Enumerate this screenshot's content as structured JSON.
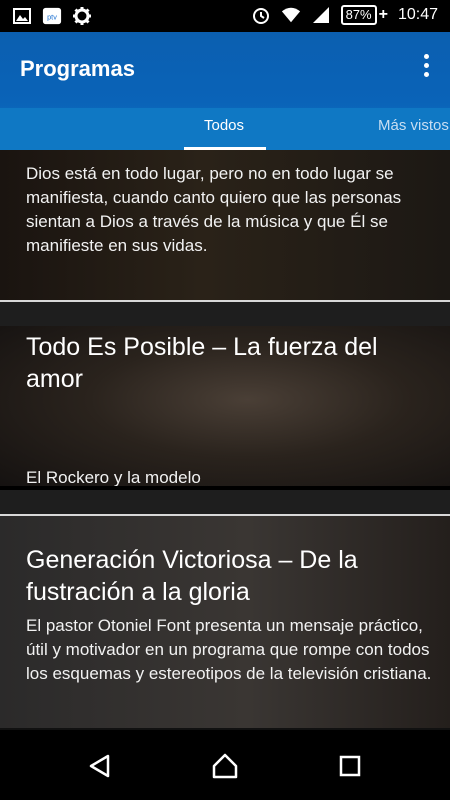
{
  "status_bar": {
    "battery_percent": "87%",
    "time": "10:47",
    "icons": [
      "image-icon",
      "app-badge-icon",
      "settings-gear-icon",
      "alarm-icon",
      "wifi-icon",
      "signal-icon",
      "battery-icon"
    ],
    "app_badge_text": "ptv"
  },
  "app_bar": {
    "title": "Programas",
    "menu_icon": "overflow-menu-icon"
  },
  "tabs": [
    {
      "label": "Todos",
      "active": true
    },
    {
      "label": "Más vistos",
      "active": false
    }
  ],
  "programs": [
    {
      "title": "",
      "description": "Dios está en todo lugar, pero no en todo lugar se manifiesta, cuando canto quiero que las personas sientan a Dios a través de la música y que Él se manifieste en sus vidas."
    },
    {
      "title": "Todo Es Posible – La fuerza del amor",
      "description": "El Rockero y la modelo"
    },
    {
      "title": "Generación Victoriosa – De la fustración a la gloria",
      "description": "El pastor Otoniel Font presenta un mensaje práctico, útil y motivador en un programa que rompe con todos los esquemas y estereotipos de la televisión cristiana."
    }
  ],
  "nav_bar": {
    "icons": [
      "back-icon",
      "home-icon",
      "recents-icon"
    ]
  },
  "colors": {
    "app_bar": "#0a63b8",
    "tab_bar": "#0f78c4",
    "tab_indicator": "#ffffff",
    "background": "#111111"
  }
}
